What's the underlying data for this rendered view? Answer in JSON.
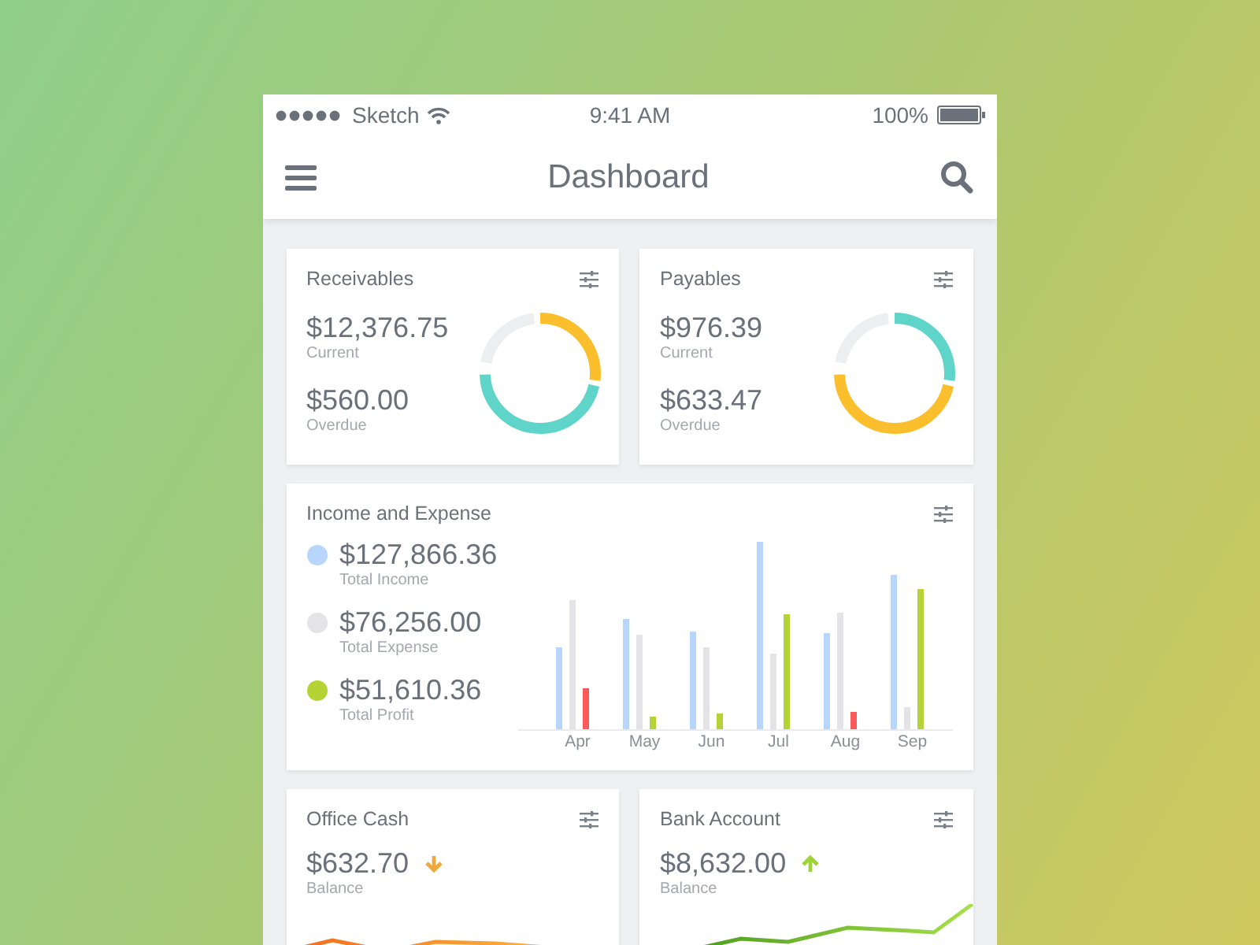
{
  "status_bar": {
    "carrier": "Sketch",
    "time": "9:41 AM",
    "battery": "100%"
  },
  "nav_bar": {
    "title": "Dashboard"
  },
  "summary_cards": [
    {
      "title": "Receivables",
      "figures": [
        {
          "amount": "$12,376.75",
          "label": "Current"
        },
        {
          "amount": "$560.00",
          "label": "Overdue"
        }
      ]
    },
    {
      "title": "Payables",
      "figures": [
        {
          "amount": "$976.39",
          "label": "Current"
        },
        {
          "amount": "$633.47",
          "label": "Overdue"
        }
      ]
    }
  ],
  "income_expense": {
    "title": "Income and Expense",
    "legend": [
      {
        "amount": "$127,866.36",
        "label": "Total Income",
        "color": "#b8d6fb"
      },
      {
        "amount": "$76,256.00",
        "label": "Total Expense",
        "color": "#e4e4e6"
      },
      {
        "amount": "$51,610.36",
        "label": "Total Profit",
        "color": "#b5d334"
      }
    ],
    "months": [
      "Apr",
      "May",
      "Jun",
      "Jul",
      "Aug",
      "Sep"
    ]
  },
  "balance_cards": [
    {
      "title": "Office Cash",
      "amount": "$632.70",
      "trend_up": false,
      "label": "Balance"
    },
    {
      "title": "Bank Account",
      "amount": "$8,632.00",
      "trend_up": true,
      "label": "Balance"
    }
  ]
}
